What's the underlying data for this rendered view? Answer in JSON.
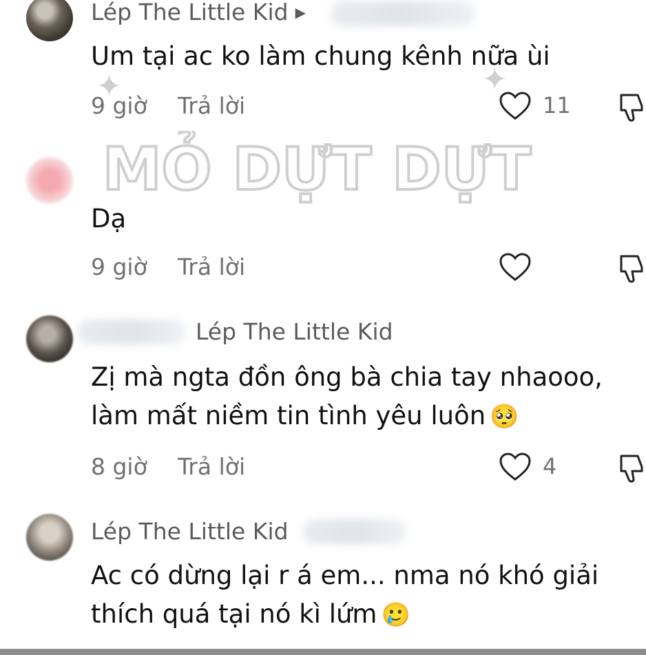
{
  "watermark": {
    "text": "MỎ DỰT DỰT"
  },
  "comments": [
    {
      "username": "Lép The Little Kid",
      "text_lines": [
        "Um tại ac ko làm chung kênh nữa ùi"
      ],
      "time": "9 giờ",
      "reply": "Trả lời",
      "likes": "11"
    },
    {
      "username": "",
      "text_lines": [
        "Dạ"
      ],
      "time": "9 giờ",
      "reply": "Trả lời",
      "likes": ""
    },
    {
      "username": "Lép The Little Kid",
      "text_lines": [
        "Zị mà ngta đồn ông bà chia tay nhaooo,",
        "làm mất niềm tin tình yêu luôn"
      ],
      "emoji": "🥺",
      "time": "8 giờ",
      "reply": "Trả lời",
      "likes": "4"
    },
    {
      "username": "Lép The Little Kid",
      "text_lines": [
        "Ac có dừng lại r á em... nma nó khó giải",
        "thích quá tại nó kì lứm"
      ],
      "emoji": "🥲"
    }
  ],
  "icons": {
    "like": "heart-outline-icon",
    "dislike": "thumbs-down-outline-icon",
    "arrow": "play-arrow-icon"
  }
}
